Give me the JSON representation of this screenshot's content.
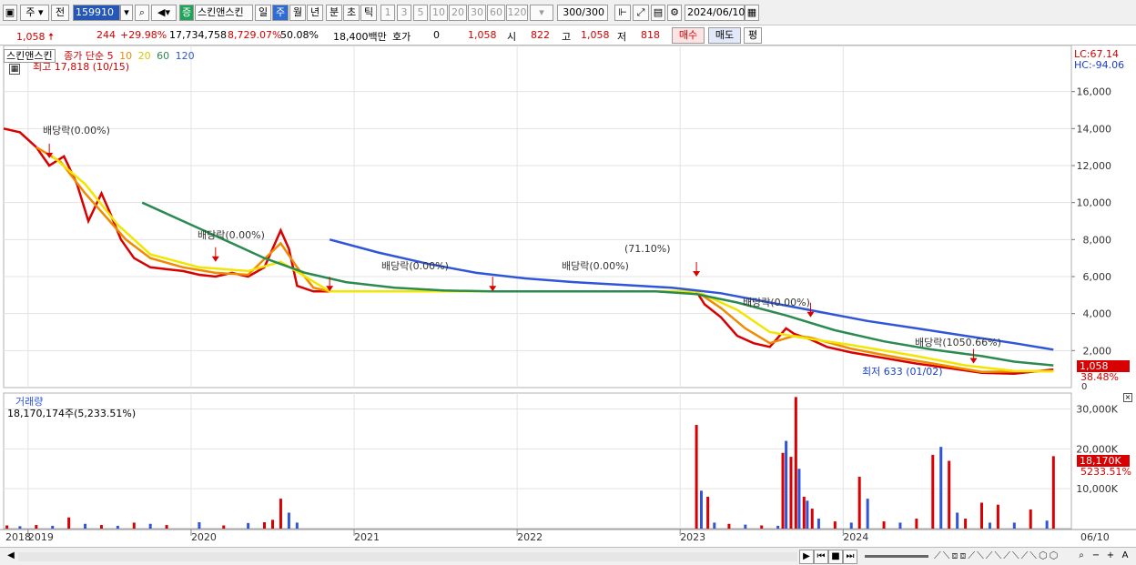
{
  "toolbar": {
    "mode": "주",
    "prev_label": "전",
    "code": "159910",
    "stock_badge": "증",
    "stock_name": "스킨앤스킨",
    "periods": [
      "일",
      "주",
      "월",
      "년",
      "분",
      "초",
      "틱"
    ],
    "active_period": "주",
    "intervals": [
      "1",
      "3",
      "5",
      "10",
      "20",
      "30",
      "60",
      "120"
    ],
    "count": "300/300",
    "date": "2024/06/10"
  },
  "info": {
    "price": "1,058",
    "change": "244",
    "change_pct": "+29.98%",
    "volume": "17,734,758",
    "volume_pct": "8,729.07%",
    "ratio": "50.08%",
    "amount": "18,400백만",
    "quote_label": "호가",
    "quote_value": "0",
    "quote_price": "1,058",
    "open_label": "시",
    "open": "822",
    "high_label": "고",
    "high": "1,058",
    "low_label": "저",
    "low": "818",
    "buy_label": "매수",
    "sell_label": "매도",
    "avg_label": "평"
  },
  "legend": {
    "name": "스킨앤스킨",
    "ma_label": "종가 단순",
    "ma_periods": [
      "5",
      "10",
      "20",
      "60",
      "120"
    ],
    "ma_colors": [
      "#d80000",
      "#f08a00",
      "#f2e600",
      "#2a8a50",
      "#2f55d8"
    ],
    "lc": "LC:67.14",
    "hc": "HC:-94.06"
  },
  "annotations": {
    "high": "최고 17,818 (10/15)",
    "low": "최저 633 (01/02)",
    "div1": "배당락(0.00%)",
    "div2": "배당락(0.00%)",
    "div3": "배당락(0.00%)",
    "div4": "배당락(0.00%)",
    "pct_71": "(71.10%)",
    "div5": "배당락(0.00%)",
    "div6": "배당락(1050.66%)",
    "current_price": "1,058",
    "current_pct": "38.48%",
    "zero": "0"
  },
  "volume_panel": {
    "title": "거래량",
    "summary": "18,170,174주(5,233.51%)",
    "current": "18,170K",
    "current_pct": "5233.51%"
  },
  "chart_data": {
    "type": "line",
    "price_axis": {
      "ticks": [
        "16,000",
        "14,000",
        "12,000",
        "10,000",
        "8,000",
        "6,000",
        "4,000",
        "2,000"
      ],
      "ylim": [
        0,
        18000
      ]
    },
    "volume_axis": {
      "ticks": [
        "30,000K",
        "20,000K",
        "10,000K"
      ],
      "ylim": [
        0,
        34000
      ]
    },
    "x_ticks": [
      "2018",
      "2019",
      "2020",
      "2021",
      "2022",
      "2023",
      "2024",
      "06/10"
    ],
    "series": [
      {
        "name": "5",
        "color": "#d80000",
        "x": [
          2018.0,
          2018.1,
          2018.2,
          2018.28,
          2018.37,
          2018.45,
          2018.52,
          2018.6,
          2018.65,
          2018.72,
          2018.8,
          2018.9,
          2019.0,
          2019.1,
          2019.2,
          2019.3,
          2019.4,
          2019.5,
          2019.6,
          2019.7,
          2019.75,
          2019.8,
          2019.9,
          2020.0,
          2020.1,
          2020.2,
          2020.25,
          2020.3,
          2020.38,
          2020.45,
          2020.6,
          2022.25,
          2022.3,
          2022.4,
          2022.5,
          2022.6,
          2022.7,
          2022.8,
          2022.85,
          2022.95,
          2023.05,
          2023.2,
          2023.4,
          2023.6,
          2023.8,
          2024.0,
          2024.2,
          2024.44
        ],
        "y": [
          14000,
          13800,
          13000,
          12000,
          12500,
          11000,
          9000,
          10500,
          9500,
          8000,
          7000,
          6500,
          6400,
          6300,
          6100,
          6000,
          6200,
          6000,
          6500,
          8500,
          7500,
          5500,
          5200,
          5200,
          5200,
          5200,
          5200,
          5200,
          5200,
          5200,
          5200,
          5200,
          4500,
          3800,
          2800,
          2400,
          2200,
          3200,
          2900,
          2600,
          2200,
          1900,
          1600,
          1300,
          1050,
          800,
          750,
          980
        ]
      },
      {
        "name": "10",
        "color": "#f08a00",
        "x": [
          2018.2,
          2018.35,
          2018.5,
          2018.6,
          2018.75,
          2018.9,
          2019.1,
          2019.3,
          2019.5,
          2019.7,
          2019.8,
          2019.9,
          2020.0,
          2020.6,
          2022.25,
          2022.4,
          2022.55,
          2022.7,
          2022.85,
          2022.95,
          2023.2,
          2023.5,
          2023.8,
          2024.0,
          2024.44
        ],
        "y": [
          13000,
          12200,
          10500,
          9500,
          8000,
          7000,
          6500,
          6200,
          6100,
          7800,
          6500,
          5400,
          5200,
          5200,
          5200,
          4300,
          3200,
          2400,
          2800,
          2700,
          2100,
          1600,
          1150,
          850,
          900
        ]
      },
      {
        "name": "20",
        "color": "#f2e600",
        "x": [
          2018.3,
          2018.5,
          2018.7,
          2018.9,
          2019.2,
          2019.5,
          2019.7,
          2019.85,
          2020.0,
          2022.25,
          2022.5,
          2022.7,
          2022.9,
          2023.2,
          2023.6,
          2023.9,
          2024.2,
          2024.44
        ],
        "y": [
          12500,
          11000,
          8800,
          7200,
          6500,
          6300,
          6800,
          6000,
          5200,
          5200,
          4200,
          3000,
          2700,
          2300,
          1700,
          1200,
          900,
          880
        ]
      },
      {
        "name": "60",
        "color": "#2a8a50",
        "x": [
          2018.85,
          2019.1,
          2019.35,
          2019.6,
          2019.85,
          2020.1,
          2020.4,
          2020.7,
          2021.0,
          2021.5,
          2022.0,
          2022.25,
          2022.5,
          2022.8,
          2023.1,
          2023.4,
          2023.7,
          2024.0,
          2024.2,
          2024.44
        ],
        "y": [
          10000,
          9000,
          8000,
          7000,
          6200,
          5700,
          5400,
          5250,
          5200,
          5200,
          5200,
          5050,
          4600,
          3900,
          3100,
          2500,
          2050,
          1700,
          1400,
          1200
        ]
      },
      {
        "name": "120",
        "color": "#2f55d8",
        "x": [
          2020.0,
          2020.3,
          2020.6,
          2020.9,
          2021.2,
          2021.5,
          2021.8,
          2022.1,
          2022.4,
          2022.7,
          2023.0,
          2023.3,
          2023.6,
          2023.9,
          2024.2,
          2024.44
        ],
        "y": [
          8000,
          7300,
          6700,
          6200,
          5900,
          5700,
          5550,
          5400,
          5100,
          4600,
          4100,
          3600,
          3200,
          2800,
          2400,
          2050
        ]
      }
    ],
    "volume": {
      "x": [
        2018.02,
        2018.1,
        2018.2,
        2018.3,
        2018.4,
        2018.5,
        2018.6,
        2018.7,
        2018.8,
        2018.9,
        2019.0,
        2019.2,
        2019.35,
        2019.5,
        2019.6,
        2019.65,
        2019.7,
        2019.75,
        2019.8,
        2022.25,
        2022.28,
        2022.32,
        2022.36,
        2022.45,
        2022.55,
        2022.65,
        2022.75,
        2022.78,
        2022.8,
        2022.83,
        2022.86,
        2022.88,
        2022.91,
        2022.93,
        2022.96,
        2023.0,
        2023.1,
        2023.2,
        2023.25,
        2023.3,
        2023.4,
        2023.5,
        2023.6,
        2023.7,
        2023.75,
        2023.8,
        2023.85,
        2023.9,
        2024.0,
        2024.05,
        2024.1,
        2024.2,
        2024.3,
        2024.4,
        2024.44
      ],
      "v": [
        800,
        600,
        900,
        700,
        2800,
        1200,
        900,
        700,
        1500,
        1200,
        900,
        1600,
        800,
        1400,
        1600,
        2200,
        7500,
        4000,
        1500,
        26000,
        9500,
        8000,
        1500,
        1200,
        1000,
        800,
        700,
        19000,
        22000,
        18000,
        33000,
        15000,
        8000,
        7000,
        5000,
        2500,
        1800,
        1500,
        13000,
        7500,
        1800,
        1500,
        2500,
        18500,
        20500,
        17000,
        4000,
        2500,
        6500,
        1500,
        6000,
        1500,
        4800,
        2000,
        18170
      ],
      "c": [
        "r",
        "b",
        "r",
        "b",
        "r",
        "b",
        "r",
        "b",
        "r",
        "b",
        "r",
        "b",
        "r",
        "b",
        "r",
        "r",
        "r",
        "b",
        "b",
        "r",
        "b",
        "r",
        "b",
        "r",
        "b",
        "r",
        "b",
        "r",
        "b",
        "r",
        "r",
        "b",
        "r",
        "b",
        "r",
        "b",
        "r",
        "b",
        "r",
        "b",
        "r",
        "b",
        "r",
        "r",
        "b",
        "r",
        "b",
        "r",
        "r",
        "b",
        "r",
        "b",
        "r",
        "b",
        "r"
      ]
    }
  }
}
